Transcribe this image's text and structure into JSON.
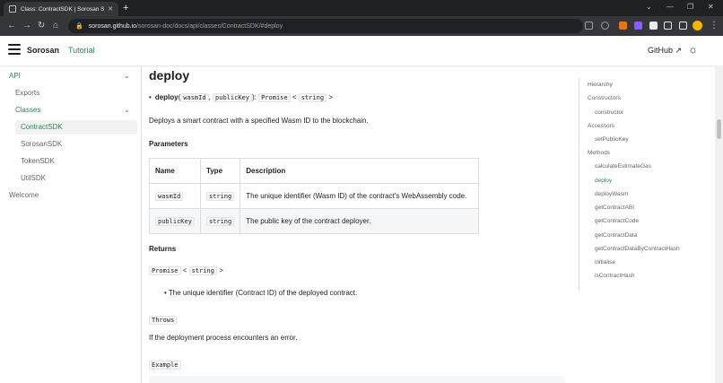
{
  "browser": {
    "tab_title": "Class: ContractSDK | Sorosan SD",
    "tab_close": "✕",
    "new_tab": "+",
    "url_host": "sorosan.github.io",
    "url_path": "/sorosan-doc/docs/api/classes/ContractSDK/#deploy",
    "window_controls": {
      "dropdown": "⌄",
      "minimize": "—",
      "restore": "❐",
      "close": "✕"
    },
    "nav": {
      "back": "←",
      "forward": "→",
      "reload": "↻",
      "home": "⌂"
    },
    "lock": "🔒"
  },
  "navbar": {
    "brand": "Sorosan",
    "tutorial": "Tutorial",
    "github": "GitHub ↗",
    "theme_icon": "☼"
  },
  "sidebar": {
    "api": "API",
    "exports": "Exports",
    "classes": "Classes",
    "items": [
      "ContractSDK",
      "SorosanSDK",
      "TokenSDK",
      "UtilSDK"
    ],
    "welcome": "Welcome",
    "chevron": "⌄"
  },
  "main": {
    "title": "deploy",
    "signature": {
      "bullet": "•",
      "name": "deploy",
      "open": "(",
      "param1": "wasmId",
      "comma": ",",
      "param2": "publicKey",
      "close": "):",
      "ret_type": "Promise",
      "lt": "<",
      "ret_inner": "string",
      "gt": ">"
    },
    "description": "Deploys a smart contract with a specified Wasm ID to the blockchain.",
    "parameters_heading": "Parameters",
    "table": {
      "headers": [
        "Name",
        "Type",
        "Description"
      ],
      "rows": [
        [
          "wasmId",
          "string",
          "The unique identifier (Wasm ID) of the contract's WebAssembly code."
        ],
        [
          "publicKey",
          "string",
          "The public key of the contract deployer."
        ]
      ]
    },
    "returns_heading": "Returns",
    "returns_type": "Promise",
    "returns_lt": "<",
    "returns_inner": "string",
    "returns_gt": ">",
    "returns_item": "The unique identifier (Contract ID) of the deployed contract.",
    "throws": "Throws",
    "throws_desc": "If the deployment process encounters an error.",
    "example": "Example"
  },
  "toc": {
    "items": [
      {
        "label": "Hierarchy",
        "level": 0
      },
      {
        "label": "Constructors",
        "level": 0
      },
      {
        "label": "constructor",
        "level": 1
      },
      {
        "label": "Accessors",
        "level": 0
      },
      {
        "label": "setPublicKey",
        "level": 1
      },
      {
        "label": "Methods",
        "level": 0
      },
      {
        "label": "calculateEstimateGas",
        "level": 1
      },
      {
        "label": "deploy",
        "level": 1
      },
      {
        "label": "deployWasm",
        "level": 1
      },
      {
        "label": "getContractABI",
        "level": 1
      },
      {
        "label": "getContractCode",
        "level": 1
      },
      {
        "label": "getContractData",
        "level": 1
      },
      {
        "label": "getContractDataByContractHash",
        "level": 1
      },
      {
        "label": "initialise",
        "level": 1
      },
      {
        "label": "isContractHash",
        "level": 1
      }
    ],
    "active": "deploy"
  },
  "colors": {
    "accent": "#2e8555",
    "chrome_dark": "#202124",
    "chrome_mid": "#35363a"
  }
}
